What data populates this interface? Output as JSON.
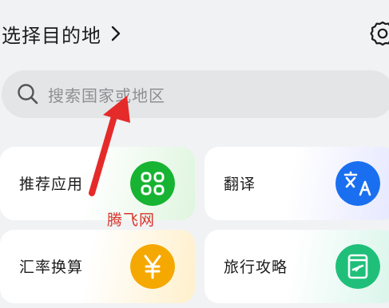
{
  "header": {
    "title": "选择目的地",
    "chevron_icon": "chevron-right-icon",
    "settings_icon": "gear-icon"
  },
  "search": {
    "placeholder": "搜索国家或地区",
    "icon": "search-icon"
  },
  "cards": [
    {
      "label": "推荐应用",
      "icon": "apps-grid-icon",
      "icon_color": "#17b332"
    },
    {
      "label": "翻译",
      "icon": "translate-icon",
      "icon_color": "#1a6ff0"
    },
    {
      "label": "汇率换算",
      "icon": "yen-icon",
      "icon_color": "#f5a800"
    },
    {
      "label": "旅行攻略",
      "icon": "guide-book-icon",
      "icon_color": "#1fbf7a"
    }
  ],
  "watermark": "腾飞网",
  "colors": {
    "annotation_arrow": "#e52a2a",
    "background": "#f1f2f4"
  }
}
